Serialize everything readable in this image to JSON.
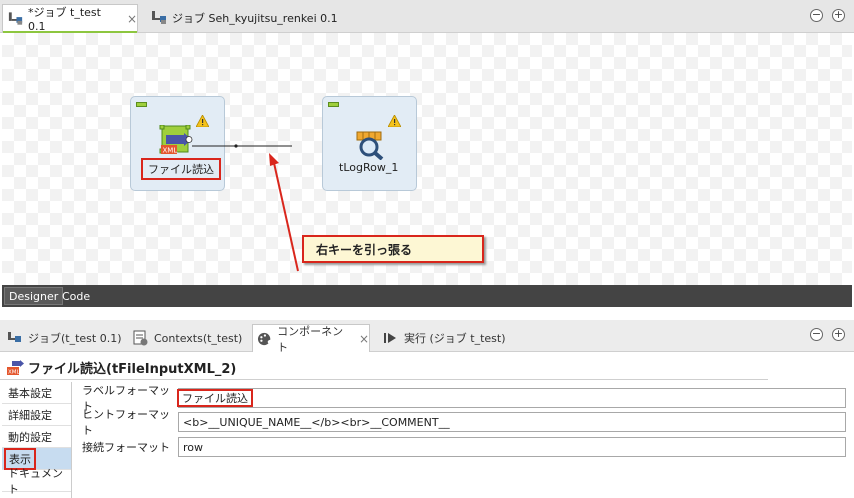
{
  "editor_tabs": [
    {
      "label": "*ジョブ t_test 0.1",
      "close": "×"
    },
    {
      "label": "ジョブ Seh_kyujitsu_renkei 0.1"
    }
  ],
  "window_controls": {
    "minimize": "−",
    "maximize": "+"
  },
  "canvas": {
    "nodes": [
      {
        "label": "ファイル読込",
        "icon": "xml-file-input-icon"
      },
      {
        "label": "tLogRow_1",
        "icon": "magnifier-log-icon"
      }
    ],
    "callout": "右キーを引っ張る",
    "accent_color": "#d9261c"
  },
  "designer_tabs": [
    "Designer",
    "Code"
  ],
  "panel_tabs": [
    {
      "label": "ジョブ(t_test 0.1)"
    },
    {
      "label": "Contexts(t_test)"
    },
    {
      "label": "コンポーネント",
      "close": "×"
    },
    {
      "label": "実行 (ジョブ t_test)"
    }
  ],
  "component": {
    "title": "ファイル読込(tFileInputXML_2)",
    "side_items": [
      "基本設定",
      "詳細設定",
      "動的設定",
      "表示",
      "ドキュメント"
    ],
    "fields": [
      {
        "label": "ラベルフォーマット",
        "value": "ファイル読込"
      },
      {
        "label": "ヒントフォーマット",
        "value": "<b>__UNIQUE_NAME__</b><br>__COMMENT__"
      },
      {
        "label": "接続フォーマット",
        "value": "row"
      }
    ]
  }
}
